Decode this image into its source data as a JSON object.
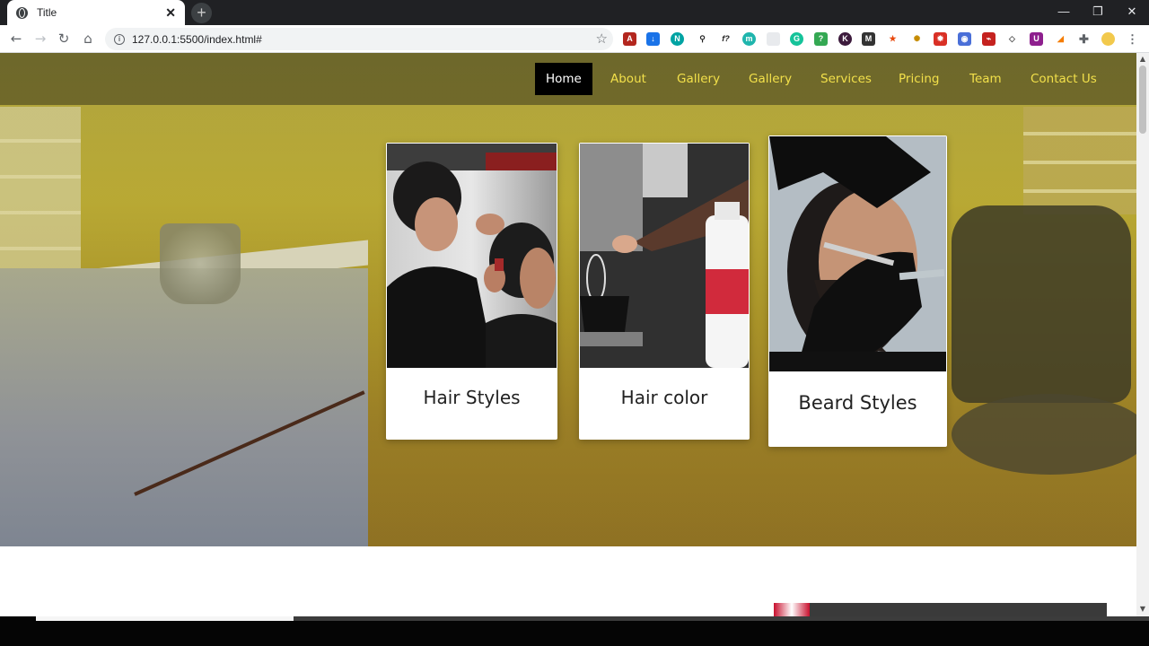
{
  "browser": {
    "tab_title": "Title",
    "tab_close": "✕",
    "new_tab": "+",
    "url": "127.0.0.1:5500/index.html#",
    "window_controls": [
      "—",
      "❐",
      "✕"
    ]
  },
  "nav": {
    "items": [
      "Home",
      "About",
      "Gallery",
      "Gallery",
      "Services",
      "Pricing",
      "Team",
      "Contact Us"
    ],
    "active_index": 0
  },
  "cards": [
    {
      "label": "Hair Styles"
    },
    {
      "label": "Hair color"
    },
    {
      "label": "Beard Styles"
    }
  ],
  "colors": {
    "nav_text": "#f2e04a",
    "nav_active_bg": "#000000"
  }
}
